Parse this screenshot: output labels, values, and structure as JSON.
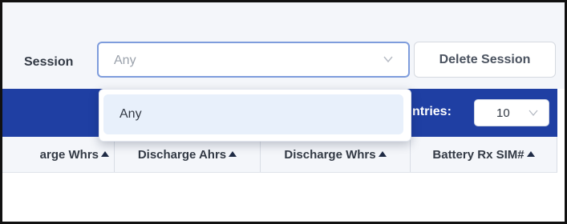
{
  "filter": {
    "session_label": "Session",
    "session_value": "Any",
    "delete_button": "Delete Session"
  },
  "dropdown": {
    "options": [
      {
        "label": "Any",
        "highlighted": true
      }
    ]
  },
  "table_controls": {
    "entries_label": "ntries:",
    "entries_value": "10"
  },
  "table": {
    "columns": [
      "arge Whrs",
      "Discharge Ahrs",
      "Discharge Whrs",
      "Battery Rx SIM#"
    ],
    "rows": []
  },
  "colors": {
    "header_bar": "#1f3fa3",
    "focus_border": "#7e9cdc",
    "highlight": "#e8f0fb"
  },
  "icons": {
    "dropdown": "chevron-down-icon",
    "sort": "sort-ascending-icon"
  }
}
